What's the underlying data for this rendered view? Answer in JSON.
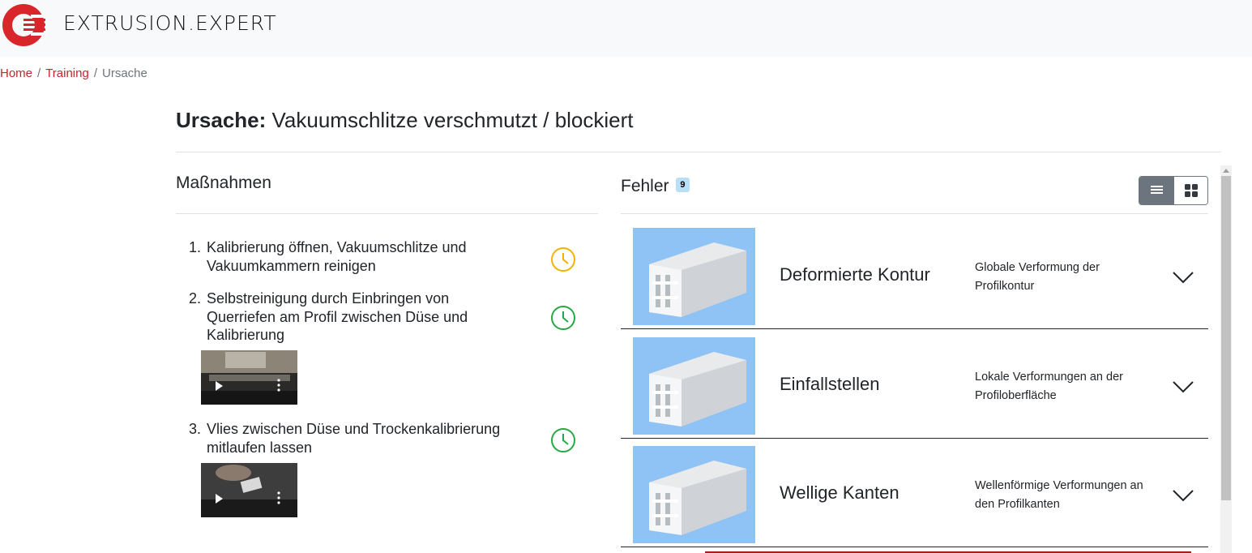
{
  "header": {
    "brand": "EXTRUSION.EXPERT",
    "brand_color": "#d8262b"
  },
  "breadcrumb": {
    "home": "Home",
    "training": "Training",
    "current": "Ursache",
    "separator": "/"
  },
  "page": {
    "title_prefix": "Ursache:",
    "title": "Vakuumschlitze verschmutzt / blockiert"
  },
  "massnahmen": {
    "title": "Maßnahmen",
    "items": [
      {
        "num": "1.",
        "text": "Kalibrierung öffnen, Vakuumschlitze und Vakuumkammern reinigen",
        "clock_color": "#f0b400",
        "has_video": false
      },
      {
        "num": "2.",
        "text": "Selbstreinigung durch Einbringen von Querriefen am Profil zwischen Düse und Kalibrierung",
        "clock_color": "#28a745",
        "has_video": true
      },
      {
        "num": "3.",
        "text": "Vlies zwischen Düse und Trockenkalibrierung mitlaufen lassen",
        "clock_color": "#28a745",
        "has_video": true
      }
    ]
  },
  "fehler": {
    "title": "Fehler",
    "count": "9",
    "view_toggle": {
      "list": "list-view-icon",
      "grid": "grid-view-icon",
      "active": "list"
    },
    "items": [
      {
        "name": "Deformierte Kontur",
        "desc": "Globale Verformung der Profilkontur"
      },
      {
        "name": "Einfallstellen",
        "desc": "Lokale Verformungen an der Profiloberfläche"
      },
      {
        "name": "Wellige Kanten",
        "desc": "Wellenförmige Verformungen an den Profilkanten"
      }
    ]
  }
}
